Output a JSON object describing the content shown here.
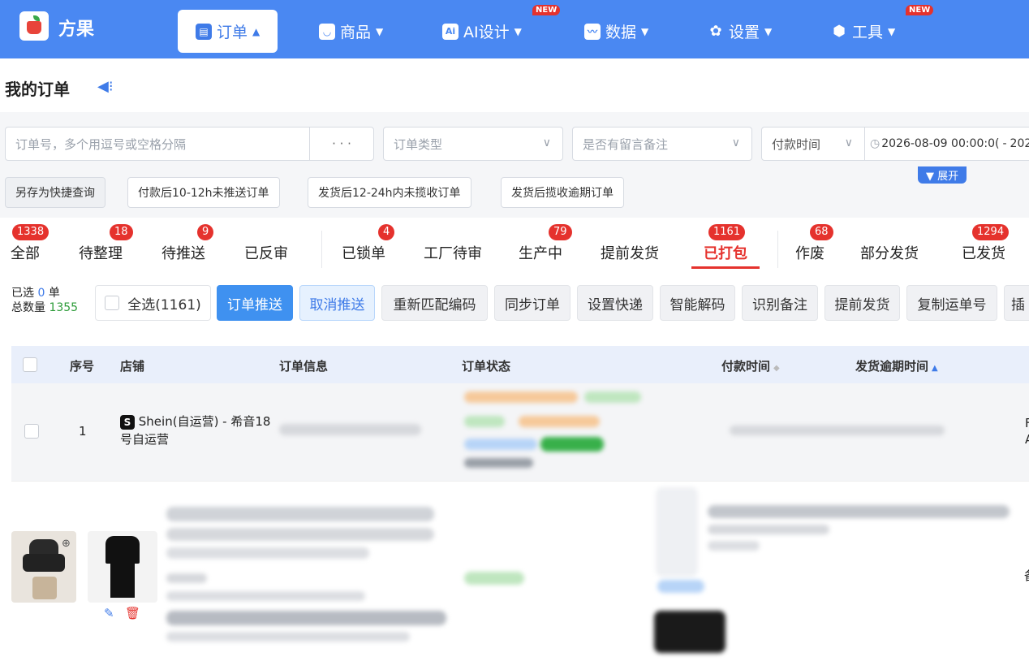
{
  "nav": {
    "brand": "方果",
    "items": [
      {
        "label": "订单",
        "icon": "clipboard-icon",
        "active": true
      },
      {
        "label": "商品",
        "icon": "bag-icon",
        "active": false
      },
      {
        "label": "AI设计",
        "icon": "ai-icon",
        "active": false,
        "badge": "NEW"
      },
      {
        "label": "数据",
        "icon": "chart-icon",
        "active": false
      },
      {
        "label": "设置",
        "icon": "gear-icon",
        "active": false
      },
      {
        "label": "工具",
        "icon": "cube-icon",
        "active": false,
        "badge": "NEW"
      }
    ]
  },
  "page": {
    "title": "我的订单"
  },
  "filters": {
    "order_no_placeholder": "订单号，多个用逗号或空格分隔",
    "more": "· · ·",
    "order_type": "订单类型",
    "remark": "是否有留言备注",
    "time_type": "付款时间",
    "date_start": "2026-08-09 00:00:0(",
    "date_sep": "-",
    "date_end": "202",
    "expand": "▼ 展开"
  },
  "quick": [
    "另存为快捷查询",
    "付款后10-12h未推送订单",
    "发货后12-24h内未揽收订单",
    "发货后揽收逾期订单"
  ],
  "tabs": [
    {
      "label": "全部",
      "count": "1338"
    },
    {
      "label": "待整理",
      "count": "18"
    },
    {
      "label": "待推送",
      "count": "9"
    },
    {
      "label": "已反审",
      "count": ""
    },
    {
      "label": "已锁单",
      "count": "4"
    },
    {
      "label": "工厂待审",
      "count": ""
    },
    {
      "label": "生产中",
      "count": "79"
    },
    {
      "label": "提前发货",
      "count": ""
    },
    {
      "label": "已打包",
      "count": "1161"
    },
    {
      "label": "作废",
      "count": "68"
    },
    {
      "label": "部分发货",
      "count": ""
    },
    {
      "label": "已发货",
      "count": "1294"
    }
  ],
  "selection": {
    "selected_label": "已选",
    "selected_count": "0",
    "selected_unit": "单",
    "total_label": "总数量",
    "total_count": "1355"
  },
  "actions": {
    "select_all": "全选(1161)",
    "push": "订单推送",
    "cancel_push": "取消推送",
    "rematch": "重新匹配编码",
    "sync": "同步订单",
    "set_express": "设置快递",
    "decode": "智能解码",
    "remark": "识别备注",
    "early_ship": "提前发货",
    "copy_waybill": "复制运单号",
    "insert": "插"
  },
  "table": {
    "headers": {
      "index": "序号",
      "shop": "店铺",
      "info": "订单信息",
      "status": "订单状态",
      "pay_time": "付款时间",
      "ship_due": "发货逾期时间"
    },
    "rows": [
      {
        "index": "1",
        "shop": "Shein(自运营) - 希音18号自运营",
        "shop_icon": "S",
        "edge_top": "F",
        "edge_bottom": "A"
      }
    ],
    "row2_edge": "备"
  },
  "colors": {
    "nav": "#4a88f2",
    "accent": "#3f7be8",
    "badge": "#e5322d"
  }
}
